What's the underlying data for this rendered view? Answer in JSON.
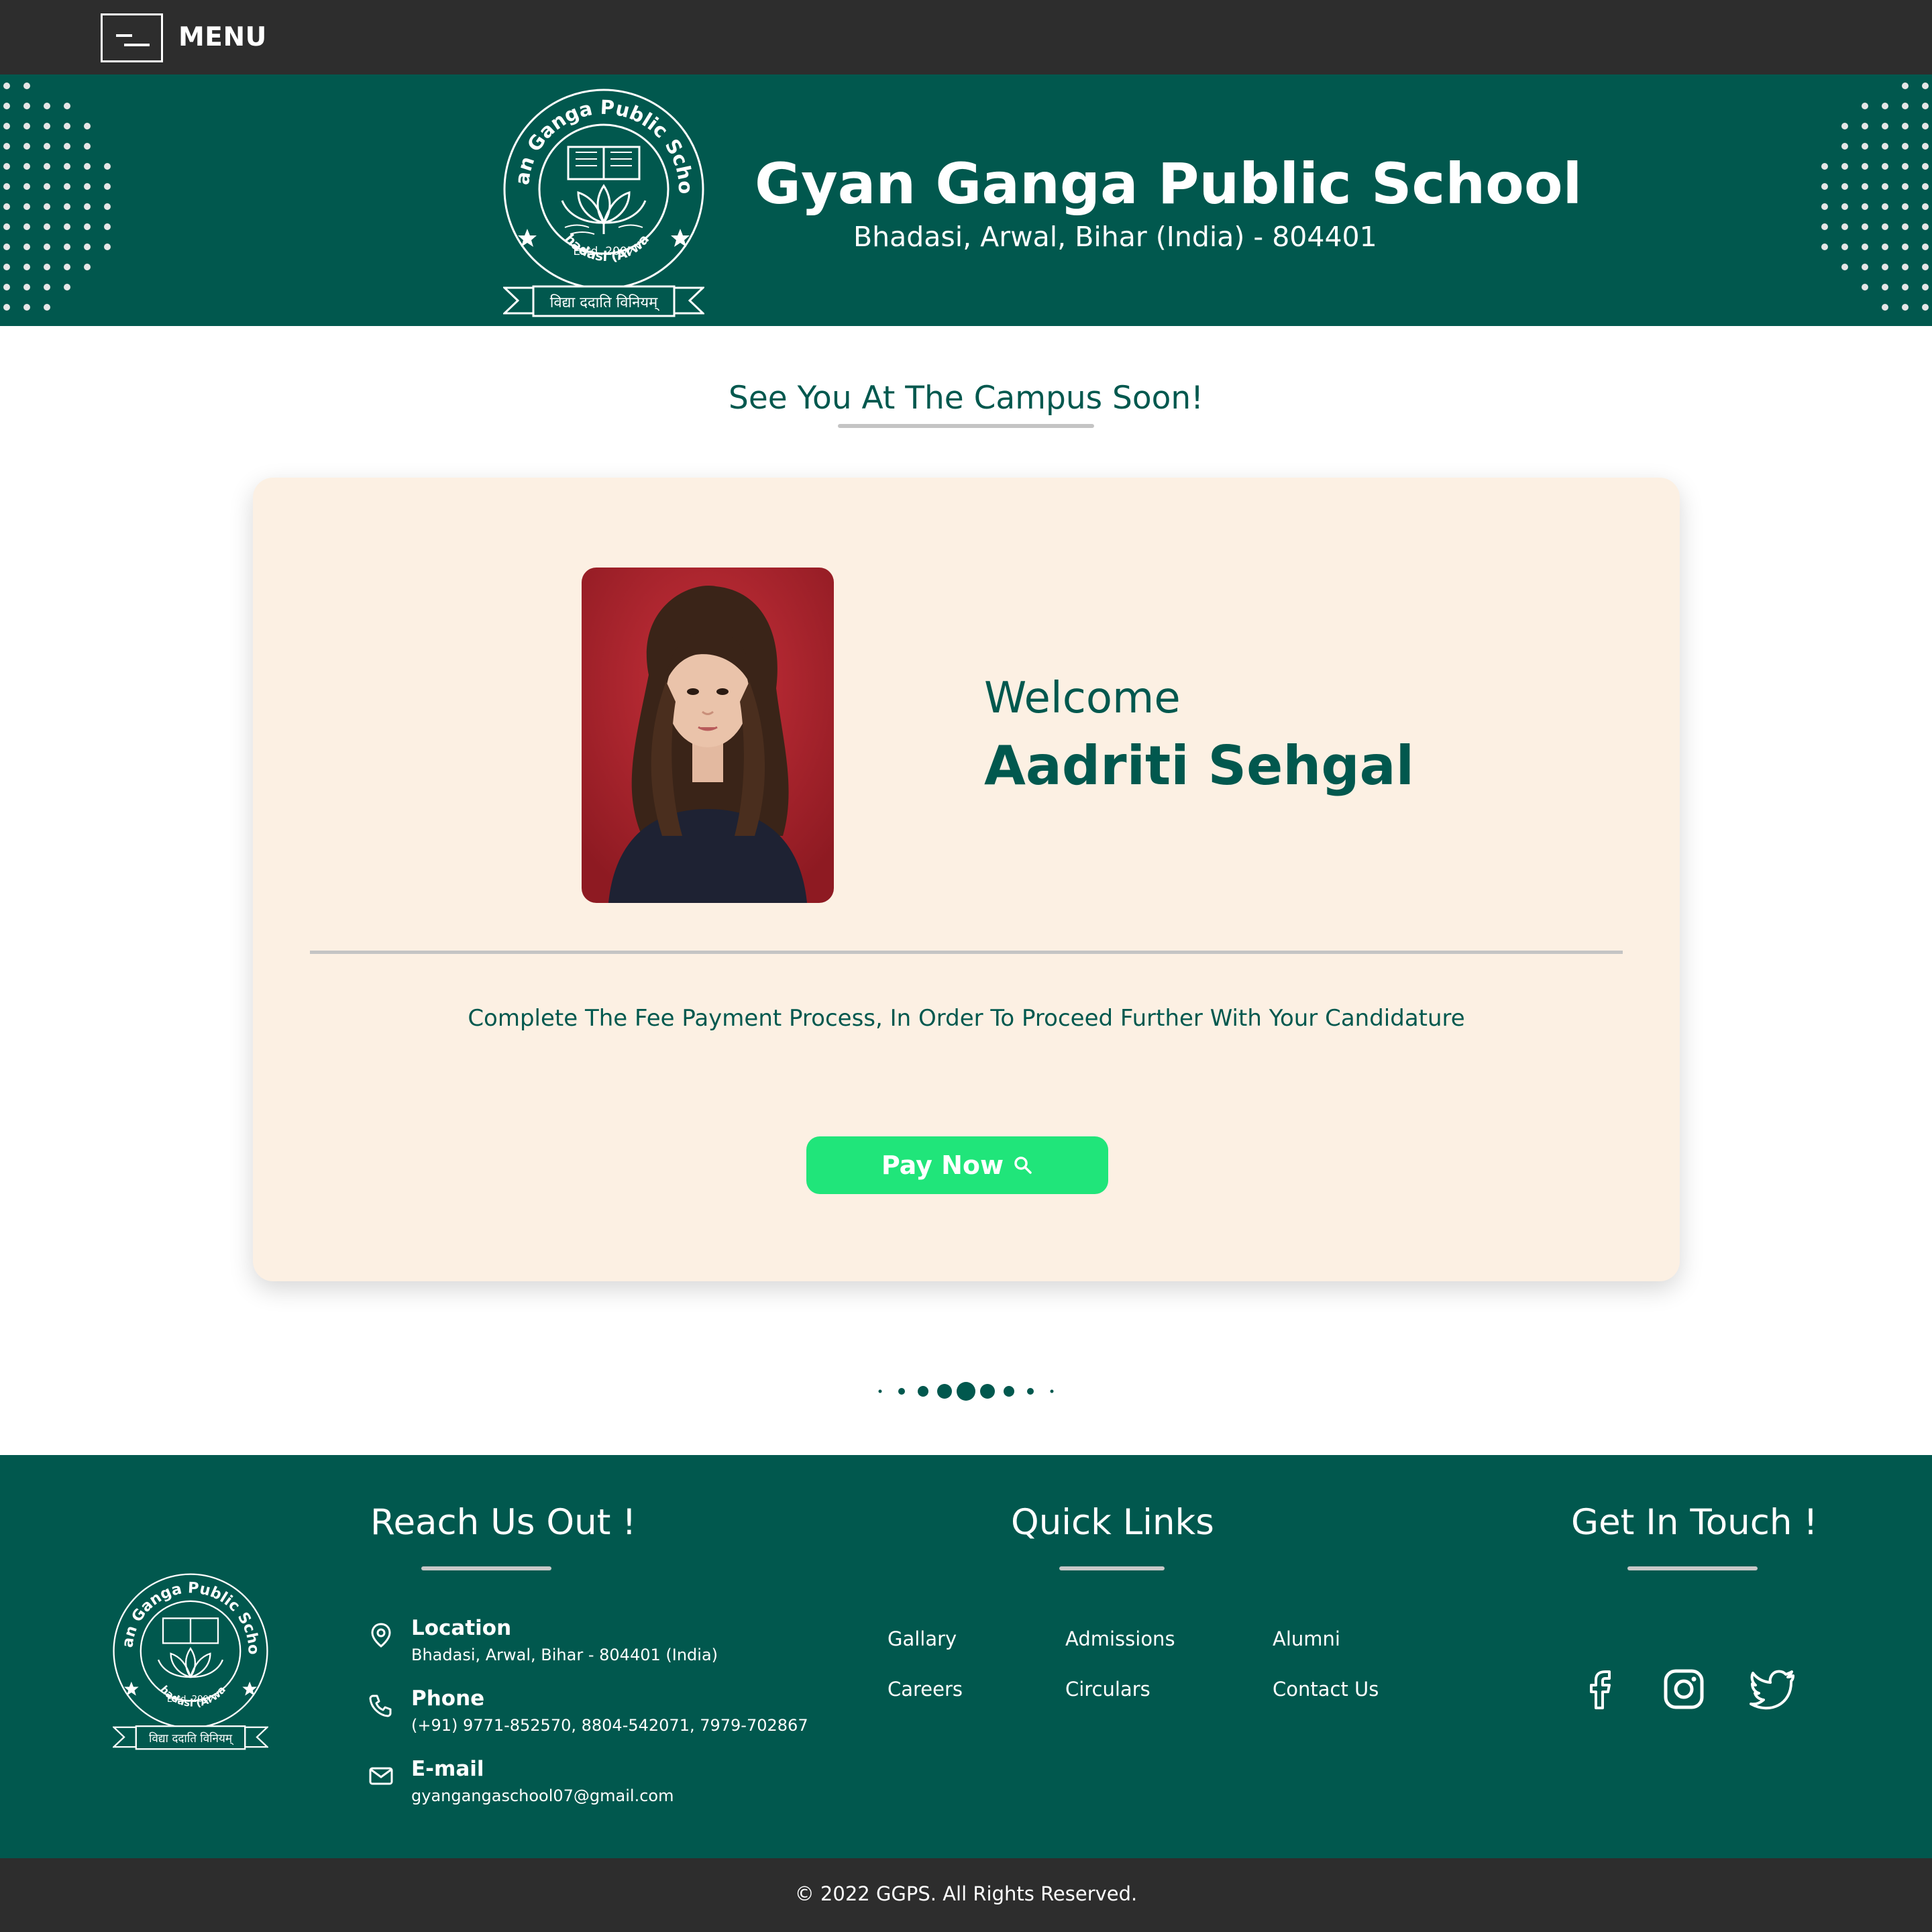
{
  "nav": {
    "menu_label": "MENU"
  },
  "header": {
    "school_name": "Gyan Ganga Public School",
    "address": "Bhadasi, Arwal, Bihar (India) - 804401"
  },
  "logo": {
    "ring_text": "Gyan Ganga Public School",
    "estd": "Estd. 2007",
    "place": "Bhadasi (Arwal)",
    "motto": "विद्या ददाति विनियम्"
  },
  "tagline": "See You At The Campus Soon!",
  "welcome": {
    "label": "Welcome",
    "student_name": "Aadriti Sehgal",
    "fee_message": "Complete The Fee Payment Process, In Order To Proceed Further With Your Candidature",
    "pay_button": "Pay Now"
  },
  "footer": {
    "reach": {
      "heading": "Reach Us Out !",
      "items": [
        {
          "title": "Location",
          "value": "Bhadasi, Arwal, Bihar - 804401 (India)",
          "icon": "location-pin-icon"
        },
        {
          "title": "Phone",
          "value": "(+91) 9771-852570, 8804-542071, 7979-702867",
          "icon": "phone-icon"
        },
        {
          "title": "E-mail",
          "value": "gyangangaschool07@gmail.com",
          "icon": "mail-icon"
        }
      ]
    },
    "quick_links": {
      "heading": "Quick Links",
      "links": [
        "Gallary",
        "Admissions",
        "Alumni",
        "Careers",
        "Circulars",
        "Contact Us"
      ]
    },
    "touch": {
      "heading": "Get In Touch !",
      "social": [
        "facebook-icon",
        "instagram-icon",
        "twitter-icon"
      ]
    }
  },
  "copyright": "© 2022 GGPS. All Rights Reserved.",
  "colors": {
    "brand_green": "#01584e",
    "dark_bar": "#2d2d2d",
    "card_bg": "#fcf0e3",
    "pay_button": "#20e57a"
  }
}
